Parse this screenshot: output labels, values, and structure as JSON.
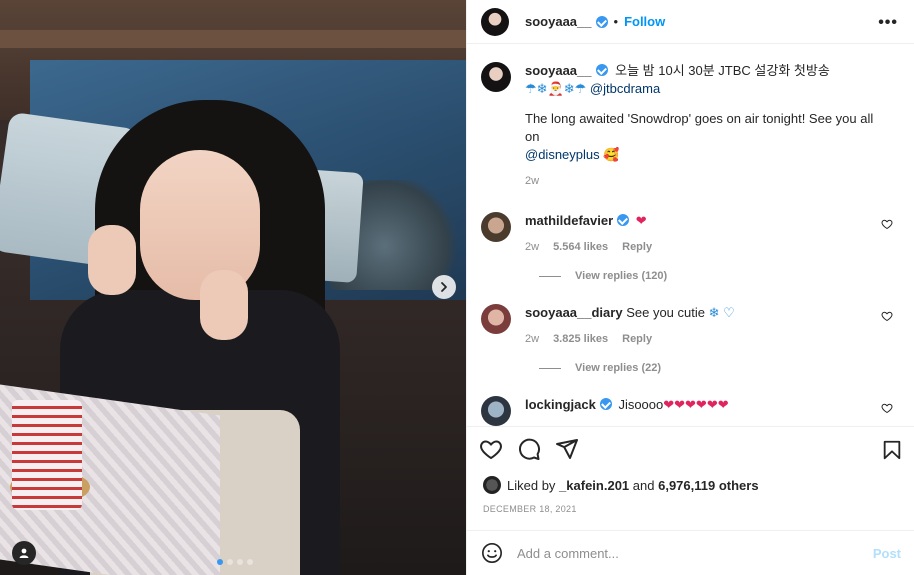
{
  "post": {
    "author": "sooyaaa__",
    "follow_label": "Follow",
    "dot": "•",
    "more": "•••"
  },
  "caption": {
    "username": "sooyaaa__",
    "line1": "오늘 밤 10시 30분 JTBC 설강화 첫방송",
    "emojis": "☂❄🎅❄☂",
    "mention": "@jtbcdrama",
    "line2": "The long awaited 'Snowdrop' goes on air tonight! See you all on",
    "mention2": "@disneyplus",
    "emoji_end": "🥰",
    "time": "2w"
  },
  "comments": [
    {
      "username": "mathildefavier",
      "text": "",
      "emoji": "❤",
      "time": "2w",
      "likes": "5.564 likes",
      "reply": "Reply",
      "view_replies": "View replies (120)"
    },
    {
      "username": "sooyaaa__diary",
      "text": "See you cutie",
      "emoji": "❄ ♡",
      "time": "2w",
      "likes": "3.825 likes",
      "reply": "Reply",
      "view_replies": "View replies (22)"
    },
    {
      "username": "lockingjack",
      "text": "Jisoooo",
      "emoji": "❤❤❤❤❤❤"
    }
  ],
  "likes": {
    "prefix": "Liked by",
    "user": "_kafein.201",
    "and": "and",
    "others": "6,976,119 others"
  },
  "date": "DECEMBER 18, 2021",
  "add_comment": {
    "placeholder": "Add a comment...",
    "post_label": "Post"
  },
  "carousel": {
    "current": 1,
    "total": 4
  },
  "colors": {
    "accent": "#0095f6",
    "verified": "#3897f0",
    "heart": "#e0245e"
  }
}
